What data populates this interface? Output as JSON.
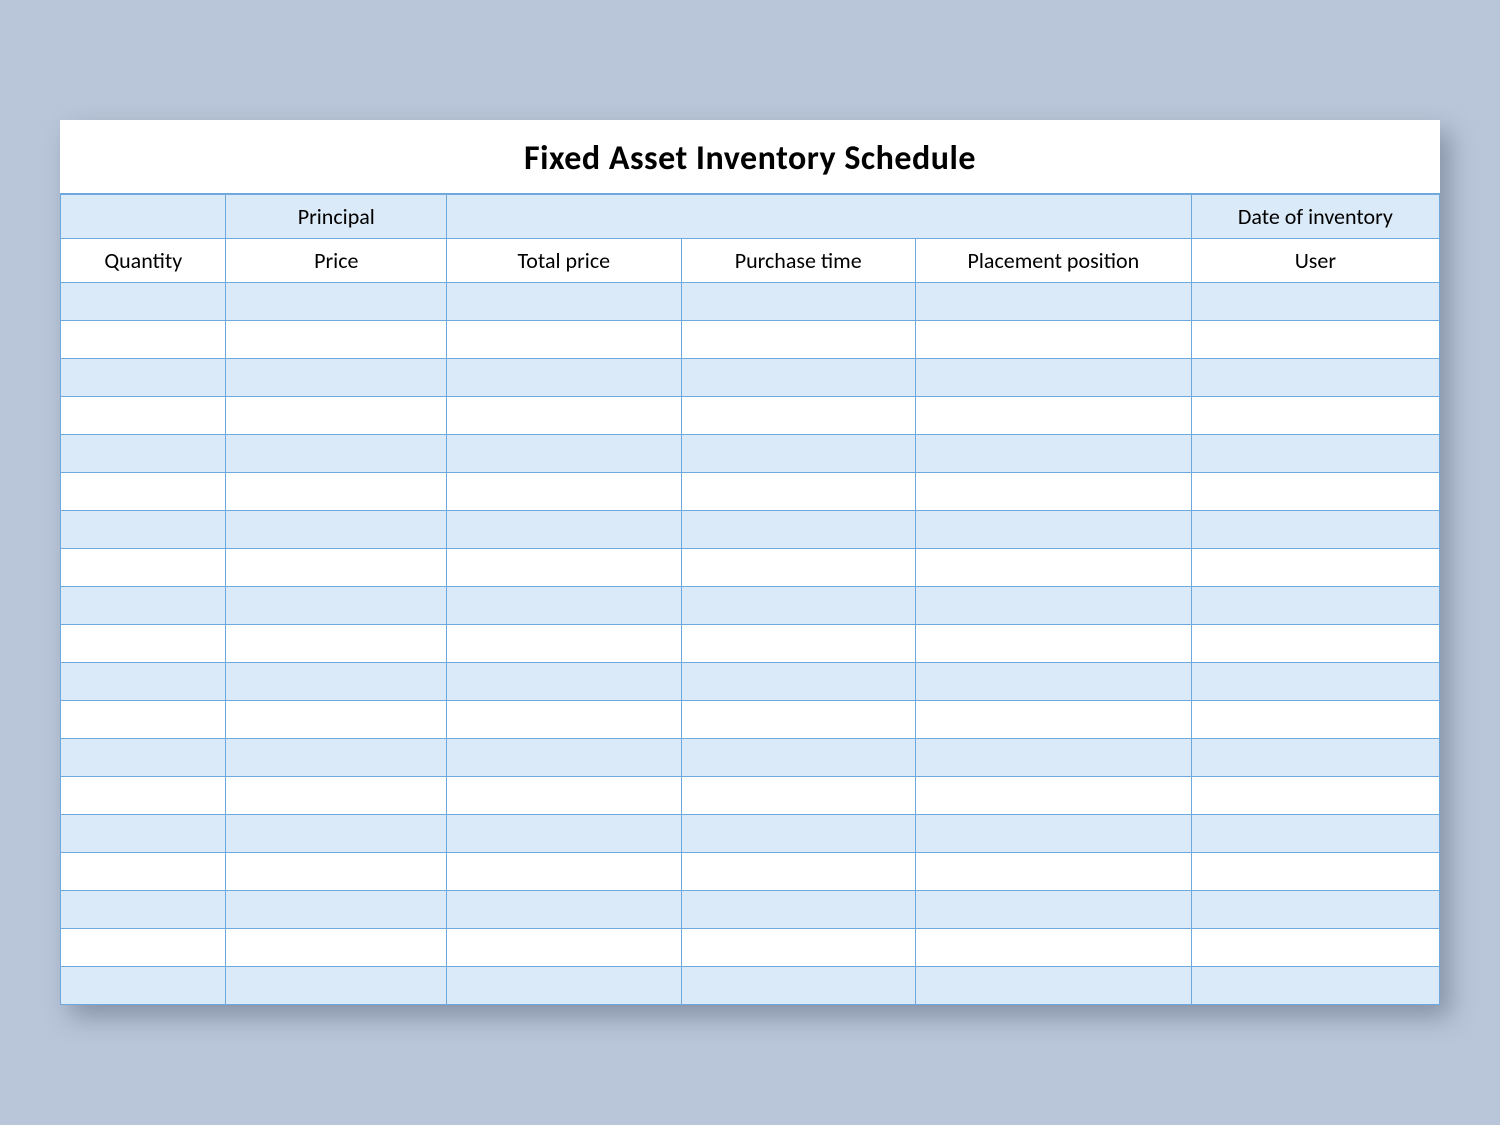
{
  "title": "Fixed Asset Inventory Schedule",
  "header1": {
    "col0": "",
    "col1": "Principal",
    "col2_4": "",
    "col5": "Date of inventory"
  },
  "header2": {
    "col0": "Quantity",
    "col1": "Price",
    "col2": "Total price",
    "col3": "Purchase time",
    "col4": "Placement position",
    "col5": "User"
  },
  "rows": [
    {
      "c0": "",
      "c1": "",
      "c2": "",
      "c3": "",
      "c4": "",
      "c5": ""
    },
    {
      "c0": "",
      "c1": "",
      "c2": "",
      "c3": "",
      "c4": "",
      "c5": ""
    },
    {
      "c0": "",
      "c1": "",
      "c2": "",
      "c3": "",
      "c4": "",
      "c5": ""
    },
    {
      "c0": "",
      "c1": "",
      "c2": "",
      "c3": "",
      "c4": "",
      "c5": ""
    },
    {
      "c0": "",
      "c1": "",
      "c2": "",
      "c3": "",
      "c4": "",
      "c5": ""
    },
    {
      "c0": "",
      "c1": "",
      "c2": "",
      "c3": "",
      "c4": "",
      "c5": ""
    },
    {
      "c0": "",
      "c1": "",
      "c2": "",
      "c3": "",
      "c4": "",
      "c5": ""
    },
    {
      "c0": "",
      "c1": "",
      "c2": "",
      "c3": "",
      "c4": "",
      "c5": ""
    },
    {
      "c0": "",
      "c1": "",
      "c2": "",
      "c3": "",
      "c4": "",
      "c5": ""
    },
    {
      "c0": "",
      "c1": "",
      "c2": "",
      "c3": "",
      "c4": "",
      "c5": ""
    },
    {
      "c0": "",
      "c1": "",
      "c2": "",
      "c3": "",
      "c4": "",
      "c5": ""
    },
    {
      "c0": "",
      "c1": "",
      "c2": "",
      "c3": "",
      "c4": "",
      "c5": ""
    },
    {
      "c0": "",
      "c1": "",
      "c2": "",
      "c3": "",
      "c4": "",
      "c5": ""
    },
    {
      "c0": "",
      "c1": "",
      "c2": "",
      "c3": "",
      "c4": "",
      "c5": ""
    },
    {
      "c0": "",
      "c1": "",
      "c2": "",
      "c3": "",
      "c4": "",
      "c5": ""
    },
    {
      "c0": "",
      "c1": "",
      "c2": "",
      "c3": "",
      "c4": "",
      "c5": ""
    },
    {
      "c0": "",
      "c1": "",
      "c2": "",
      "c3": "",
      "c4": "",
      "c5": ""
    },
    {
      "c0": "",
      "c1": "",
      "c2": "",
      "c3": "",
      "c4": "",
      "c5": ""
    },
    {
      "c0": "",
      "c1": "",
      "c2": "",
      "c3": "",
      "c4": "",
      "c5": ""
    }
  ]
}
